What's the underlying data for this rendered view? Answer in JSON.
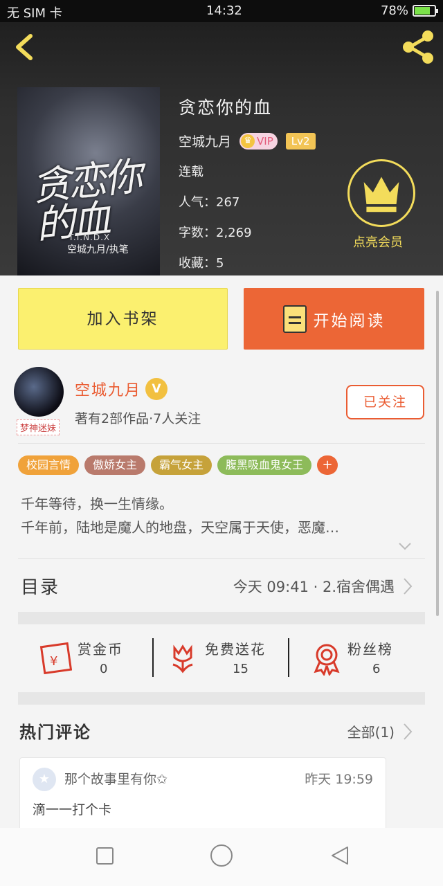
{
  "status_bar": {
    "carrier": "无 SIM 卡",
    "time": "14:32",
    "battery": "78%",
    "battery_level": 0.78
  },
  "book": {
    "title": "贪恋你的血",
    "author": "空城九月",
    "vip_label": "VIP",
    "level": "Lv2",
    "status": "连载",
    "popularity": "人气：267",
    "word_count": "字数：2,269",
    "favorites": "收藏：5",
    "cover_title": "贪恋你的血",
    "cover_sub": "T.I.N.D.X",
    "cover_author": "空城九月/执笔"
  },
  "vip_promo": {
    "label": "点亮会员"
  },
  "actions": {
    "shelf": "加入书架",
    "read": "开始阅读"
  },
  "author_info": {
    "name": "空城九月",
    "verified_mark": "V",
    "meta": "著有2部作品·7人关注",
    "tag": "梦神迷妹",
    "follow_label": "已关注"
  },
  "tags": [
    {
      "label": "校园言情",
      "color": "#f0a23a"
    },
    {
      "label": "傲娇女主",
      "color": "#b97a6c"
    },
    {
      "label": "霸气女主",
      "color": "#c6a23a"
    },
    {
      "label": "腹黑吸血鬼女王",
      "color": "#8dbb5a"
    }
  ],
  "tag_more": "+",
  "description": {
    "line1": "千年等待，换一生情缘。",
    "line2": "千年前，陆地是魔人的地盘，天空属于天使，恶魔…"
  },
  "catalog": {
    "label": "目录",
    "latest": "今天 09:41 · 2.宿舍偶遇"
  },
  "rewards": [
    {
      "label": "赏金币",
      "value": "0"
    },
    {
      "label": "免费送花",
      "value": "15"
    },
    {
      "label": "粉丝榜",
      "value": "6"
    }
  ],
  "comments": {
    "header": "热门评论",
    "all": "全部(1)",
    "items": [
      {
        "user": "那个故事里有你✩",
        "time": "昨天 19:59",
        "text": "滴一一打个卡"
      }
    ]
  },
  "colors": {
    "accent": "#ec6636",
    "shelf_button": "#fbf06f",
    "vip_gold": "#f3dc5b"
  }
}
